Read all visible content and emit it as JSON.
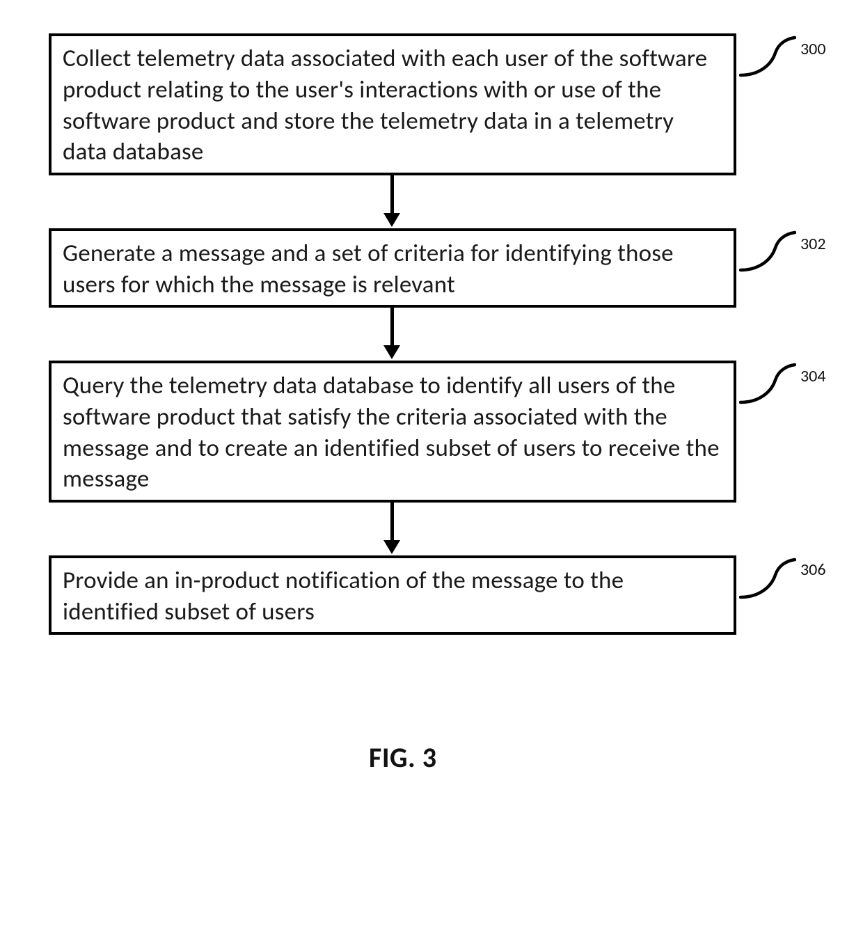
{
  "figure_caption": "FIG. 3",
  "steps": [
    {
      "ref": "300",
      "text": "Collect telemetry data associated with each user of the software product relating to the user's interactions with or use of the software product and store the telemetry data in a telemetry data database"
    },
    {
      "ref": "302",
      "text": "Generate a message and a set of criteria for identifying those users for which the message is relevant"
    },
    {
      "ref": "304",
      "text": "Query the telemetry data database to identify all users of the software product that satisfy the criteria associated with the message and to create an identified subset of users to receive the message"
    },
    {
      "ref": "306",
      "text": "Provide an in-product notification of the message to the identified subset of users"
    }
  ]
}
